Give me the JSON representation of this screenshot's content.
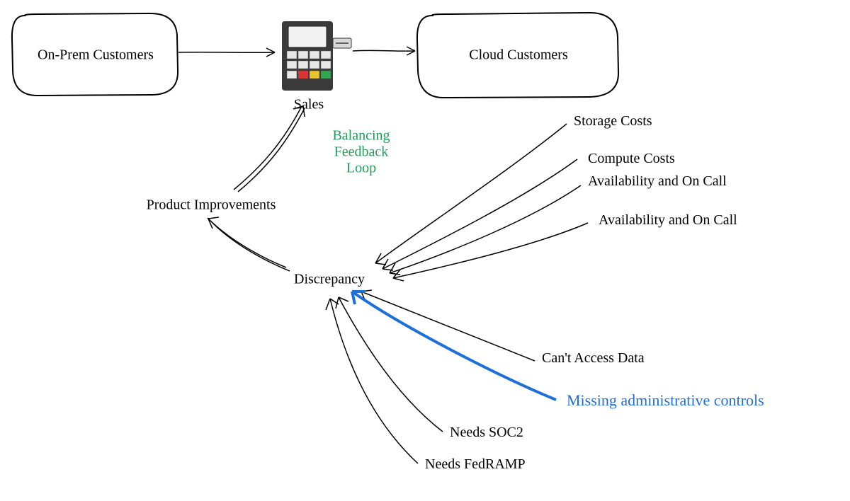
{
  "nodes": {
    "on_prem": "On-Prem Customers",
    "cloud": "Cloud Customers",
    "sales": "Sales",
    "product_improvements": "Product Improvements",
    "discrepancy": "Discrepancy",
    "balancing_line1": "Balancing",
    "balancing_line2": "Feedback",
    "balancing_line3": "Loop"
  },
  "inputs_to_discrepancy": {
    "storage_costs": "Storage Costs",
    "compute_costs": "Compute Costs",
    "availability_1": "Availability and On Call",
    "availability_2": "Availability and On Call",
    "cant_access_data": "Can't Access Data",
    "missing_admin_controls": "Missing administrative controls",
    "needs_soc2": "Needs SOC2",
    "needs_fedramp": "Needs FedRAMP"
  },
  "highlight_color": "#1e6fd9",
  "accent_color": "#1e9e5a"
}
